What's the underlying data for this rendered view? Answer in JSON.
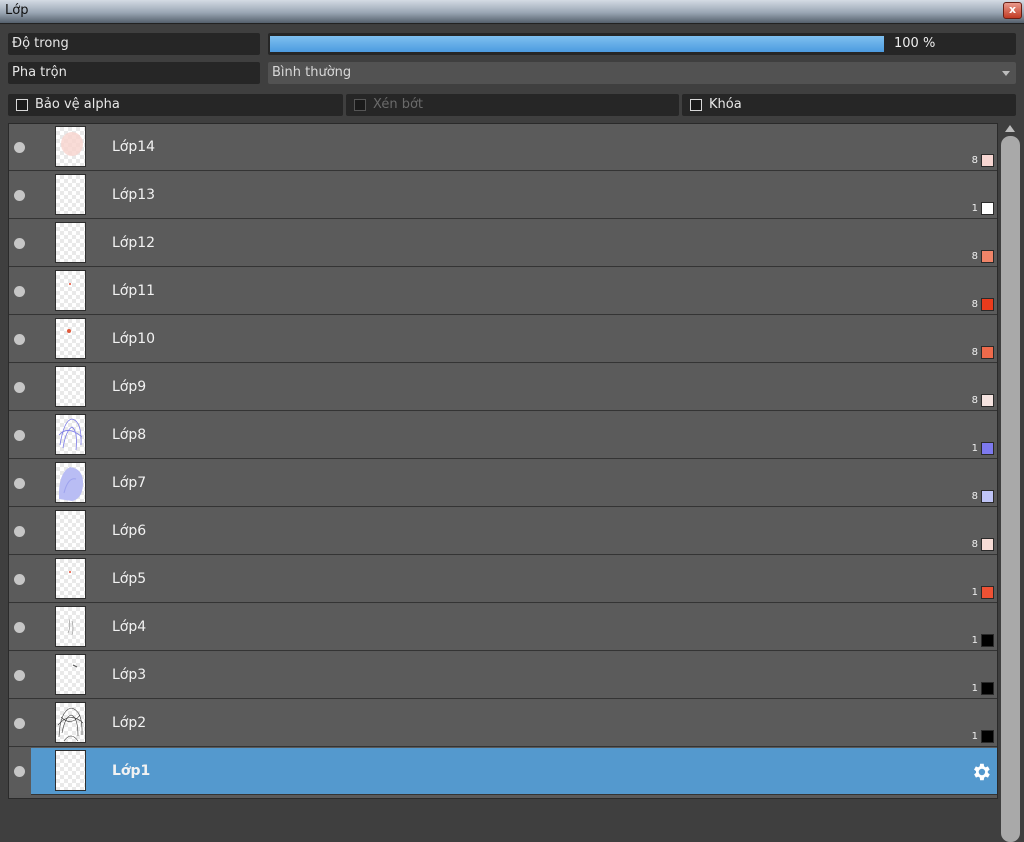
{
  "window": {
    "title": "Lớp",
    "close_label": "x"
  },
  "opacity": {
    "label": "Độ trong",
    "value_text": "100 %",
    "fraction": 1.0,
    "fill_color": "#5aa7e6"
  },
  "blend": {
    "label": "Pha trộn",
    "value": "Bình thường"
  },
  "options": {
    "protect_alpha": {
      "label": "Bảo vệ alpha",
      "checked": false
    },
    "clip": {
      "label": "Xén bớt",
      "checked": false,
      "disabled": true
    },
    "lock": {
      "label": "Khóa",
      "checked": false
    }
  },
  "layers": [
    {
      "name": "Lớp14",
      "count": "8",
      "color": "#f7d6d2",
      "thumb": "blush"
    },
    {
      "name": "Lớp13",
      "count": "1",
      "color": "#ffffff",
      "thumb": "blank"
    },
    {
      "name": "Lớp12",
      "count": "8",
      "color": "#f08468",
      "thumb": "blank"
    },
    {
      "name": "Lớp11",
      "count": "8",
      "color": "#ea3b1c",
      "thumb": "dot-small"
    },
    {
      "name": "Lớp10",
      "count": "8",
      "color": "#ee6a4b",
      "thumb": "dot"
    },
    {
      "name": "Lớp9",
      "count": "8",
      "color": "#f5e3e0",
      "thumb": "blank"
    },
    {
      "name": "Lớp8",
      "count": "1",
      "color": "#7d79ee",
      "thumb": "lines-blue"
    },
    {
      "name": "Lớp7",
      "count": "8",
      "color": "#bfc4f7",
      "thumb": "fill-blue"
    },
    {
      "name": "Lớp6",
      "count": "8",
      "color": "#f7dcd6",
      "thumb": "blank"
    },
    {
      "name": "Lớp5",
      "count": "1",
      "color": "#ee5134",
      "thumb": "dot-small"
    },
    {
      "name": "Lớp4",
      "count": "1",
      "color": "#000000",
      "thumb": "sketch-light"
    },
    {
      "name": "Lớp3",
      "count": "1",
      "color": "#000000",
      "thumb": "mark"
    },
    {
      "name": "Lớp2",
      "count": "1",
      "color": "#000000",
      "thumb": "sketch"
    },
    {
      "name": "Lớp1",
      "count": "",
      "color": "",
      "thumb": "blank",
      "selected": true,
      "icon": "gear-icon"
    }
  ],
  "icons": {
    "visibility": "visibility-dot-icon",
    "settings": "gear-icon",
    "scroll_up": "scroll-up-arrow-icon"
  },
  "colors": {
    "selected_row": "#5499ce",
    "row": "#5b5b5b",
    "panel": "#3f3f3f"
  }
}
